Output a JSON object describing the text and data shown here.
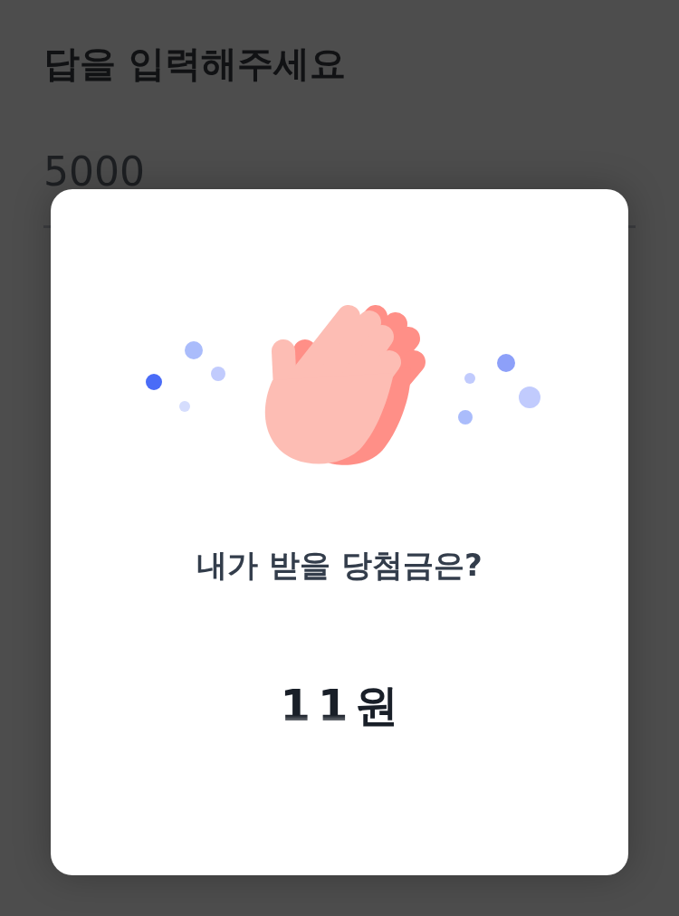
{
  "page": {
    "title": "답을 입력해주세요",
    "answer_field": {
      "value": "5000"
    }
  },
  "modal": {
    "question": "내가 받을 당첨금은?",
    "amount": {
      "digits": [
        "1",
        "1"
      ],
      "unit": "원"
    }
  }
}
